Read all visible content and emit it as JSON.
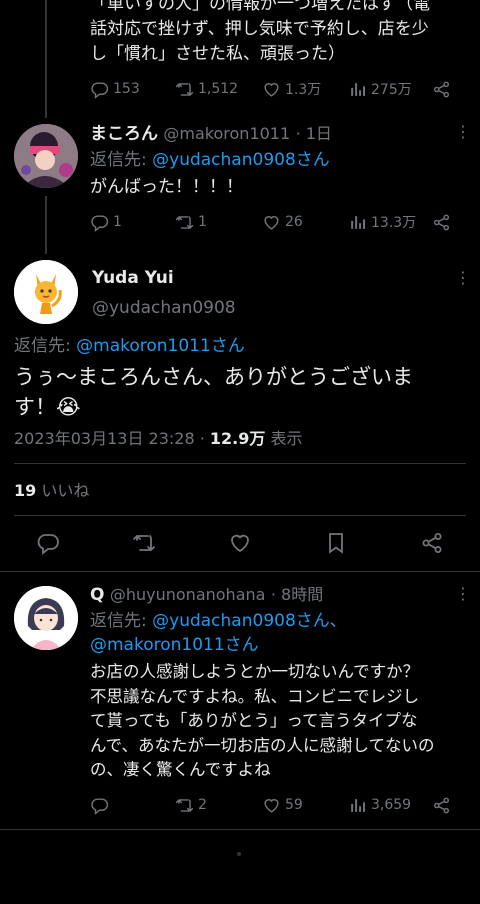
{
  "top_tweet": {
    "text_lines": [
      "「車いすの人」の情報が一つ増えたはず（電",
      "話対応で挫けず、押し気味で予約し、店を少",
      "し「慣れ」させた私、頑張った）"
    ],
    "replies": "153",
    "retweets": "1,512",
    "likes": "1.3万",
    "views": "275万"
  },
  "reply1": {
    "name": "まころん",
    "handle": "@makoron1011",
    "time": "· 1日",
    "reply_to_label": "返信先: ",
    "reply_to": "@yudachan0908さん",
    "text": "がんばった！！！！",
    "replies": "1",
    "retweets": "1",
    "likes": "26",
    "views": "13.3万"
  },
  "main": {
    "name": "Yuda Yui",
    "handle": "@yudachan0908",
    "reply_to_label": "返信先: ",
    "reply_to": "@makoron1011さん",
    "text_line1": "うぅ〜まころんさん、ありがとうございま",
    "text_line2": "す！😭",
    "timestamp": "2023年03月13日 23:28 · ",
    "views_count": "12.9万",
    "views_label": " 表示",
    "likes_count": "19",
    "likes_label": " いいね"
  },
  "reply2": {
    "name": "Q",
    "handle": "@huyunonanohana",
    "time": "· 8時間",
    "reply_to_label": "返信先: ",
    "reply_to_1": "@yudachan0908さん、",
    "reply_to_2": "@makoron1011さん",
    "text_lines": [
      "お店の人感謝しようとか一切ないんですか？",
      "不思議なんですよね。私、コンビニでレジし",
      "て貰っても「ありがとう」って言うタイプな",
      "んで、あなたが一切お店の人に感謝してないの",
      "の、凄く驚くんですよね"
    ],
    "replies": "",
    "retweets": "2",
    "likes": "59",
    "views": "3,659"
  },
  "colors": {
    "background": "#000000",
    "link": "#1d9bf0",
    "muted": "#71767b",
    "divider": "#2f3336"
  }
}
